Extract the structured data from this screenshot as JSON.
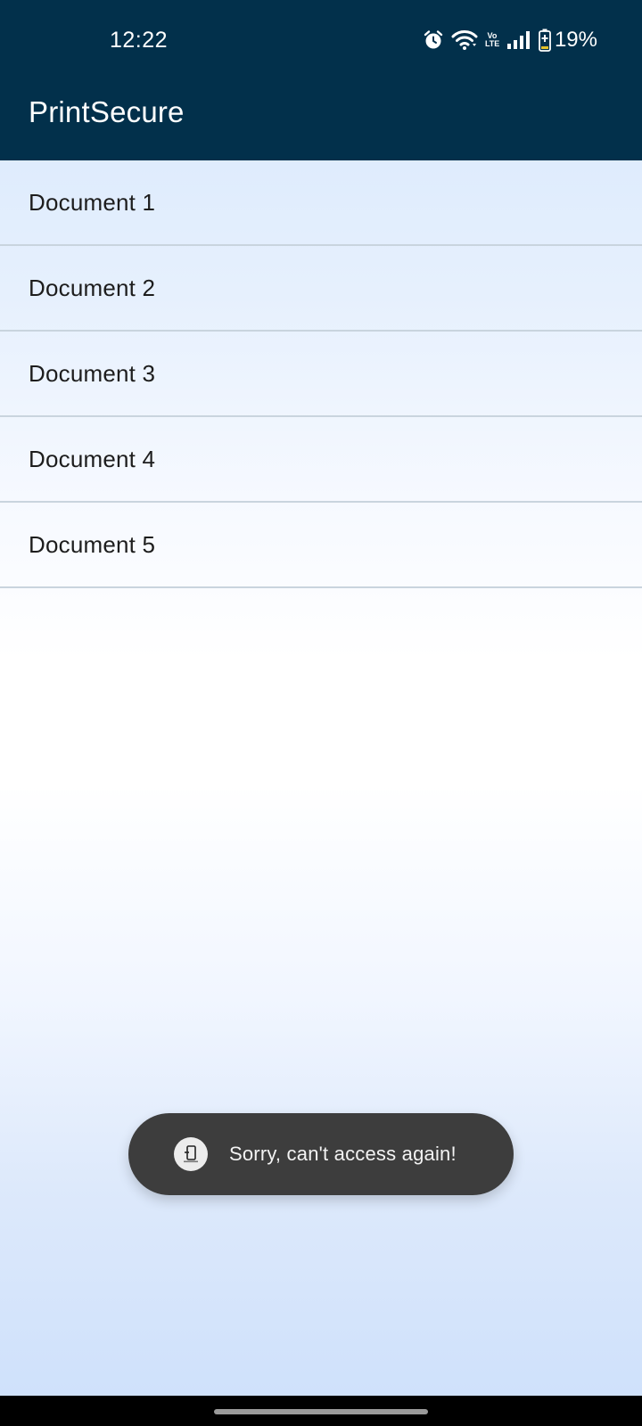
{
  "status_bar": {
    "time": "12:22",
    "volte_line1": "Vo",
    "volte_line2": "LTE",
    "battery": "19%"
  },
  "app_bar": {
    "title": "PrintSecure"
  },
  "documents": [
    {
      "label": "Document 1"
    },
    {
      "label": "Document 2"
    },
    {
      "label": "Document 3"
    },
    {
      "label": "Document 4"
    },
    {
      "label": "Document 5"
    }
  ],
  "toast": {
    "message": "Sorry, can't access again!",
    "icon": "app-icon"
  },
  "colors": {
    "app_bar": "#02304b",
    "toast_bg": "#3d3d3d",
    "divider": "#c9d4de"
  }
}
